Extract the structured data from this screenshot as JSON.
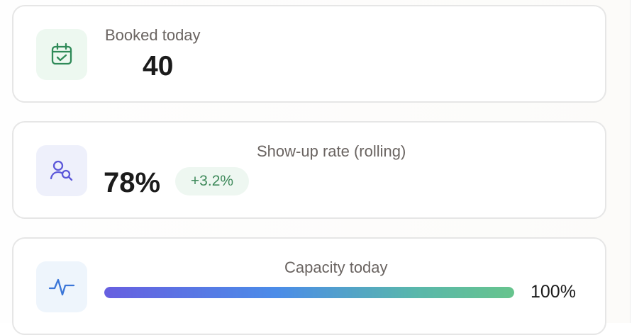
{
  "stats": [
    {
      "label": "Booked today",
      "value": "40",
      "icon": "calendar-check-icon",
      "accent": "#2f8a58",
      "icon_bg": "#edf8f0"
    },
    {
      "label": "Show-up rate (rolling)",
      "value": "78%",
      "change": "+3.2%",
      "icon": "user-search-icon",
      "accent": "#5b57d9",
      "icon_bg": "#eef0fb",
      "change_color": "#3f8a5b"
    },
    {
      "label": "Capacity today",
      "percent_text": "100%",
      "progress": 1.0,
      "icon": "activity-pulse-icon",
      "accent": "#3a76d8",
      "icon_bg": "#eef5fc"
    }
  ]
}
